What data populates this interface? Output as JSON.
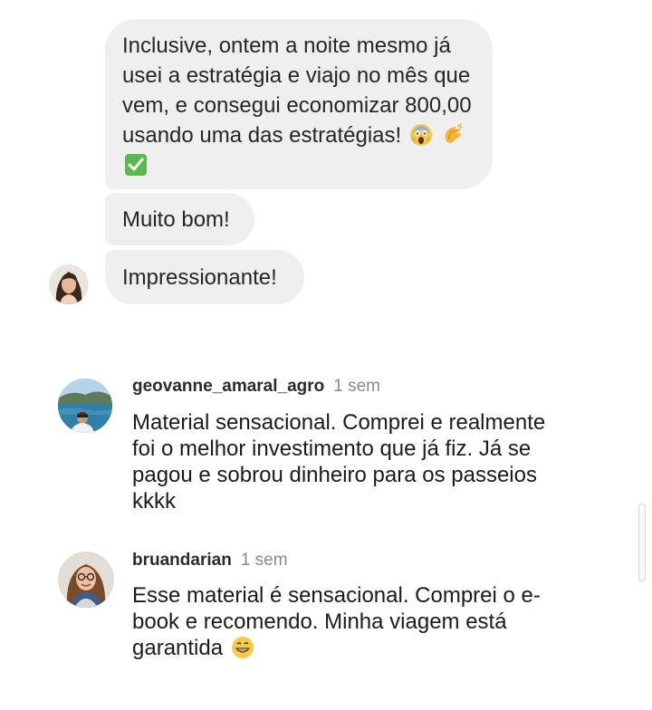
{
  "chat": {
    "messages": [
      {
        "text": "Inclusive, ontem a noite mesmo já usei a estratégia e viajo no mês que vem, e consegui economizar 800,00 usando uma das estratégias!",
        "emojis": [
          "face-screaming-icon",
          "clapping-hands-icon",
          "check-mark-button-icon"
        ]
      },
      {
        "text": "Muito bom!"
      },
      {
        "text": "Impressionante!"
      }
    ],
    "sender_avatar": "woman-avatar"
  },
  "comments": [
    {
      "username": "geovanne_amaral_agro",
      "time": "1 sem",
      "text": "Material sensacional. Comprei e realmente foi o melhor investimento que já fiz. Já se pagou e sobrou dinheiro para os passeios kkkk",
      "avatar": "man-lake-avatar"
    },
    {
      "username": "bruandarian",
      "time": "1 sem",
      "text": "Esse material é sensacional. Comprei o e-book e recomendo. Minha viagem está garantida",
      "emoji": "grinning-face-icon",
      "avatar": "woman-glasses-avatar"
    }
  ],
  "colors": {
    "bubble": "#efefef",
    "username": "#2b2b2b",
    "time": "#8a8a8a"
  }
}
